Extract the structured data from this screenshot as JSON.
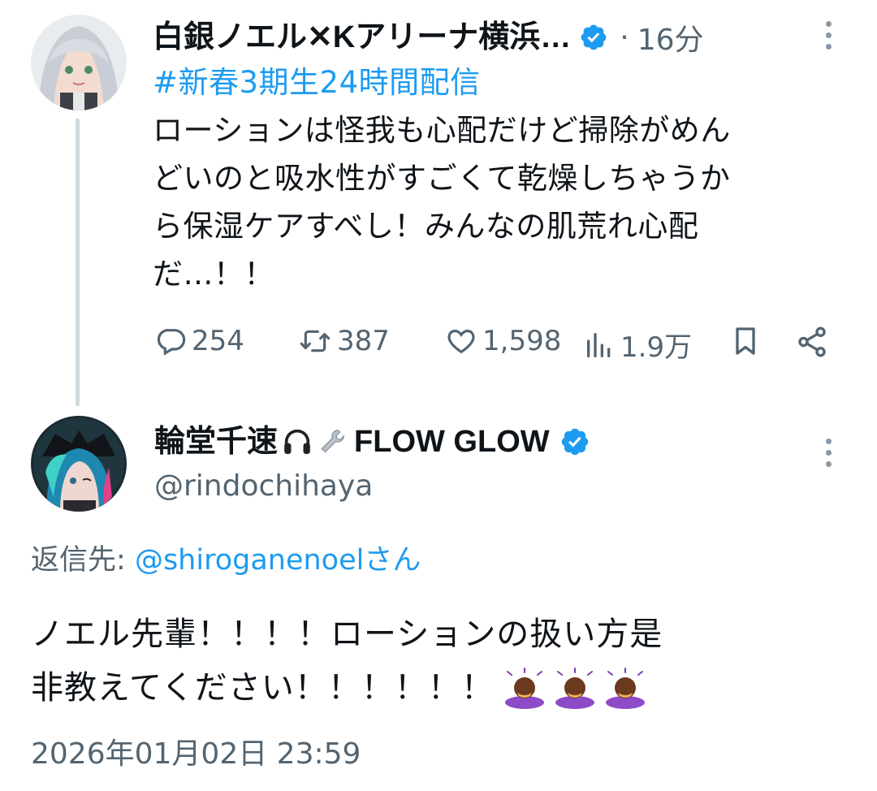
{
  "tweet": {
    "author_name": "白銀ノエル✕Kアリーナ横浜…",
    "time_sep": "·",
    "time": "16分",
    "hashtag": "#新春3期生24時間配信",
    "text_lines": [
      "ローションは怪我も心配だけど掃除がめん",
      "どいのと吸水性がすごくて乾燥しちゃうか",
      "ら保湿ケアすべし！みんなの肌荒れ心配",
      "だ…！！"
    ],
    "actions": {
      "replies": "254",
      "retweets": "387",
      "likes": "1,598",
      "views": "1.9万"
    }
  },
  "reply": {
    "author_name": "輪堂千速",
    "author_suffix": "FLOW GLOW",
    "handle": "@rindochihaya",
    "replying_to_label": "返信先:",
    "replying_to_user": "@shiroganenoelさん",
    "text_lines": [
      "ノエル先輩！！！！ローションの扱い方是",
      "非教えてください！！！！！！"
    ],
    "timestamp": "2026年01月02日 23:59"
  },
  "colors": {
    "accent": "#1d9bf0",
    "muted": "#536471",
    "verified": "#1d9bf0"
  },
  "icons": {
    "verified": "verified-badge-icon",
    "more": "more-vertical-icon",
    "reply": "reply-icon",
    "retweet": "retweet-icon",
    "like": "heart-icon",
    "views": "views-icon",
    "bookmark": "bookmark-icon",
    "share": "share-icon",
    "headphones": "headphones-emoji",
    "wrench": "wrench-emoji",
    "bowing": "bowing-person-emoji"
  }
}
